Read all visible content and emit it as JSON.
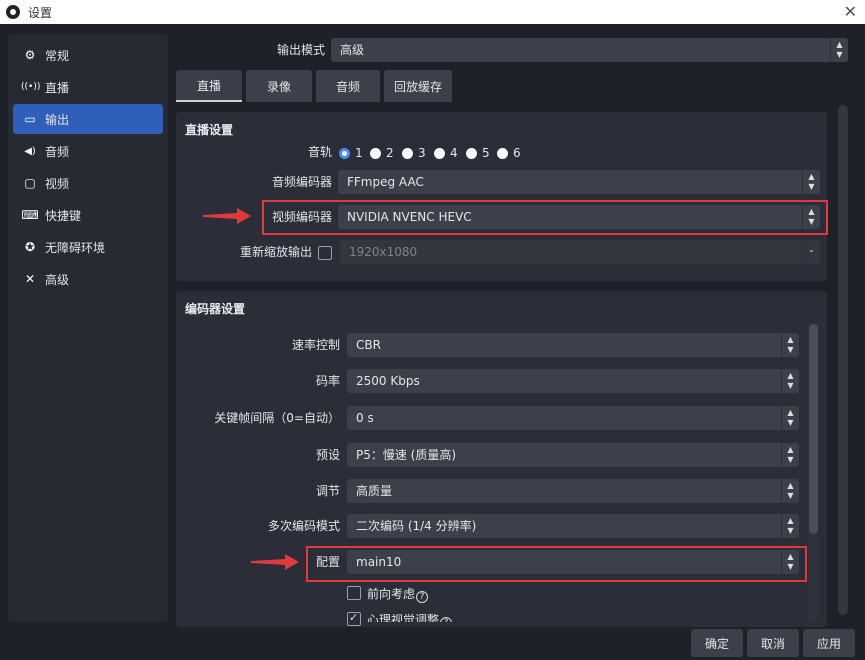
{
  "window": {
    "title": "设置"
  },
  "sidebar": {
    "items": [
      {
        "label": "常规",
        "icon": "gear-icon",
        "glyph": "⚙"
      },
      {
        "label": "直播",
        "icon": "broadcast-icon",
        "glyph": "((•))"
      },
      {
        "label": "输出",
        "icon": "output-icon",
        "glyph": "▭"
      },
      {
        "label": "音频",
        "icon": "speaker-icon",
        "glyph": "◀)"
      },
      {
        "label": "视频",
        "icon": "monitor-icon",
        "glyph": "▢"
      },
      {
        "label": "快捷键",
        "icon": "keyboard-icon",
        "glyph": "⌨"
      },
      {
        "label": "无障碍环境",
        "icon": "accessibility-icon",
        "glyph": "✪"
      },
      {
        "label": "高级",
        "icon": "tools-icon",
        "glyph": "✕"
      }
    ],
    "active_index": 2
  },
  "output_mode": {
    "label": "输出模式",
    "value": "高级"
  },
  "tabs": [
    {
      "label": "直播"
    },
    {
      "label": "录像"
    },
    {
      "label": "音频"
    },
    {
      "label": "回放缓存"
    }
  ],
  "stream_settings": {
    "title": "直播设置",
    "audio_track": {
      "label": "音轨",
      "options": [
        "1",
        "2",
        "3",
        "4",
        "5",
        "6"
      ],
      "selected": "1"
    },
    "audio_encoder": {
      "label": "音频编码器",
      "value": "FFmpeg AAC"
    },
    "video_encoder": {
      "label": "视频编码器",
      "value": "NVIDIA NVENC HEVC"
    },
    "rescale": {
      "label": "重新缩放输出",
      "checked": false,
      "value": "1920x1080"
    }
  },
  "encoder_settings": {
    "title": "编码器设置",
    "rate_control": {
      "label": "速率控制",
      "value": "CBR"
    },
    "bitrate": {
      "label": "码率",
      "value": "2500 Kbps"
    },
    "keyframe": {
      "label": "关键帧间隔（0=自动）",
      "value": "0 s"
    },
    "preset": {
      "label": "预设",
      "value": "P5：慢速 (质量高)"
    },
    "tuning": {
      "label": "调节",
      "value": "高质量"
    },
    "multipass": {
      "label": "多次编码模式",
      "value": "二次编码 (1/4 分辨率)"
    },
    "profile": {
      "label": "配置",
      "value": "main10"
    },
    "lookahead": {
      "label": "前向考虑",
      "checked": false
    },
    "psycho_visual": {
      "label": "心理视觉调整",
      "checked": true
    }
  },
  "footer": {
    "ok": "确定",
    "cancel": "取消",
    "apply": "应用"
  },
  "colors": {
    "accent": "#2f5fb8",
    "highlight": "#e03a3a",
    "background": "#1f2129"
  }
}
